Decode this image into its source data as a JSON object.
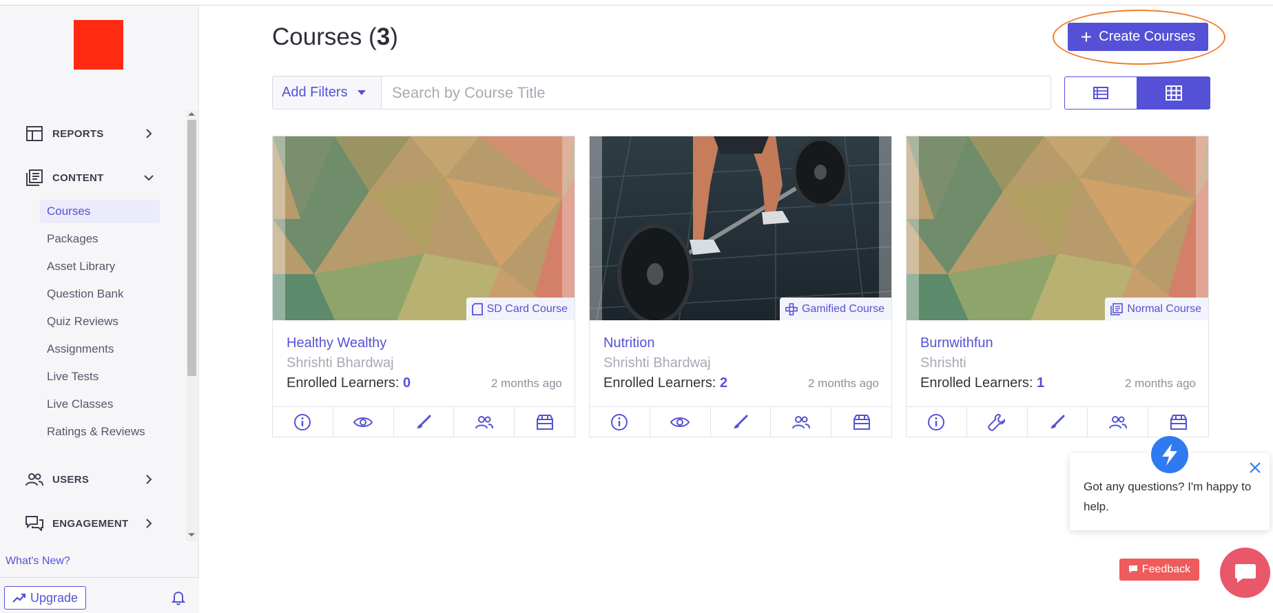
{
  "colors": {
    "accent": "#5451d6",
    "logo": "#ff2a12",
    "highlight": "#f07d2a",
    "feedback": "#ef5b5b",
    "chat": "#2f7af0"
  },
  "sidebar": {
    "sections": [
      {
        "label": "REPORTS",
        "icon": "reports-icon"
      },
      {
        "label": "CONTENT",
        "icon": "content-icon"
      },
      {
        "label": "USERS",
        "icon": "users-icon"
      },
      {
        "label": "ENGAGEMENT",
        "icon": "engagement-icon"
      }
    ],
    "content_items": [
      {
        "label": "Courses",
        "active": true
      },
      {
        "label": "Packages"
      },
      {
        "label": "Asset Library"
      },
      {
        "label": "Question Bank"
      },
      {
        "label": "Quiz Reviews"
      },
      {
        "label": "Assignments"
      },
      {
        "label": "Live Tests"
      },
      {
        "label": "Live Classes"
      },
      {
        "label": "Ratings & Reviews"
      }
    ],
    "whats_new": "What's New?",
    "upgrade_label": "Upgrade"
  },
  "header": {
    "title": "Courses",
    "count": "3",
    "create_label": "Create Courses"
  },
  "toolbar": {
    "filters_label": "Add Filters",
    "search_placeholder": "Search by Course Title"
  },
  "courses": [
    {
      "title": "Healthy Wealthy",
      "author": "Shrishti Bhardwaj",
      "enrolled_label": "Enrolled Learners:",
      "enrolled": "0",
      "ago": "2 months ago",
      "badge": "SD Card Course",
      "badge_icon": "sd-card-icon"
    },
    {
      "title": "Nutrition",
      "author": "Shrishti Bhardwaj",
      "enrolled_label": "Enrolled Learners:",
      "enrolled": "2",
      "ago": "2 months ago",
      "badge": "Gamified Course",
      "badge_icon": "gamified-icon"
    },
    {
      "title": "Burnwithfun",
      "author": "Shrishti",
      "enrolled_label": "Enrolled Learners:",
      "enrolled": "1",
      "ago": "2 months ago",
      "badge": "Normal Course",
      "badge_icon": "normal-course-icon"
    }
  ],
  "chat": {
    "message": "Got any questions? I'm happy to help.",
    "feedback_label": "Feedback"
  }
}
